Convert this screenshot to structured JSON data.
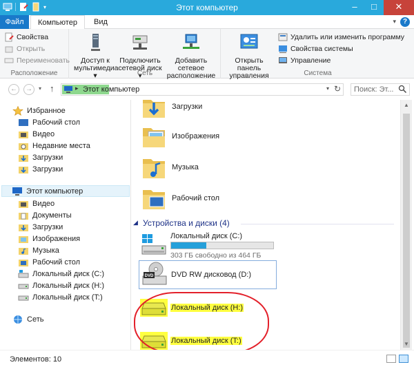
{
  "window": {
    "title": "Этот компьютер"
  },
  "ribbon_tabs": {
    "file": "Файл",
    "computer": "Компьютер",
    "view": "Вид"
  },
  "ribbon": {
    "location": {
      "properties": "Свойства",
      "open": "Открыть",
      "rename": "Переименовать",
      "group_label": "Расположение"
    },
    "network": {
      "media_access_l1": "Доступ к",
      "media_access_l2": "мультимедиа",
      "map_drive_l1": "Подключить",
      "map_drive_l2": "сетевой диск",
      "add_location_l1": "Добавить сетевое",
      "add_location_l2": "расположение",
      "group_label": "Сеть"
    },
    "system": {
      "control_panel_l1": "Открыть панель",
      "control_panel_l2": "управления",
      "uninstall": "Удалить или изменить программу",
      "sys_props": "Свойства системы",
      "manage": "Управление",
      "group_label": "Система"
    }
  },
  "address": {
    "path": "Этот компьютер",
    "search_placeholder": "Поиск: Эт..."
  },
  "nav": {
    "favorites": "Избранное",
    "fav_items": [
      "Рабочий стол",
      "Видео",
      "Недавние места",
      "Загрузки",
      "Загрузки"
    ],
    "this_pc": "Этот компьютер",
    "pc_items": [
      "Видео",
      "Документы",
      "Загрузки",
      "Изображения",
      "Музыка",
      "Рабочий стол",
      "Локальный диск (C:)",
      "Локальный диск (H:)",
      "Локальный диск (T:)"
    ],
    "network": "Сеть"
  },
  "content": {
    "folders": [
      "Загрузки",
      "Изображения",
      "Музыка",
      "Рабочий стол"
    ],
    "group_header": "Устройства и диски (4)",
    "drive_c": {
      "label": "Локальный диск (C:)",
      "free": "303 ГБ свободно из 464 ГБ",
      "used_fraction": 0.347
    },
    "dvd": {
      "label": "DVD RW дисковод (D:)",
      "badge": "DVD"
    },
    "drive_h": {
      "label": "Локальный диск (H:)"
    },
    "drive_t": {
      "label": "Локальный диск (T:)"
    }
  },
  "status": {
    "items": "Элементов: 10"
  },
  "colors": {
    "title_bar": "#29a9dc",
    "file_tab": "#1979ca",
    "highlight": "#ffff40",
    "annotation": "#e3202a",
    "drive_fill": "#26a0da"
  }
}
